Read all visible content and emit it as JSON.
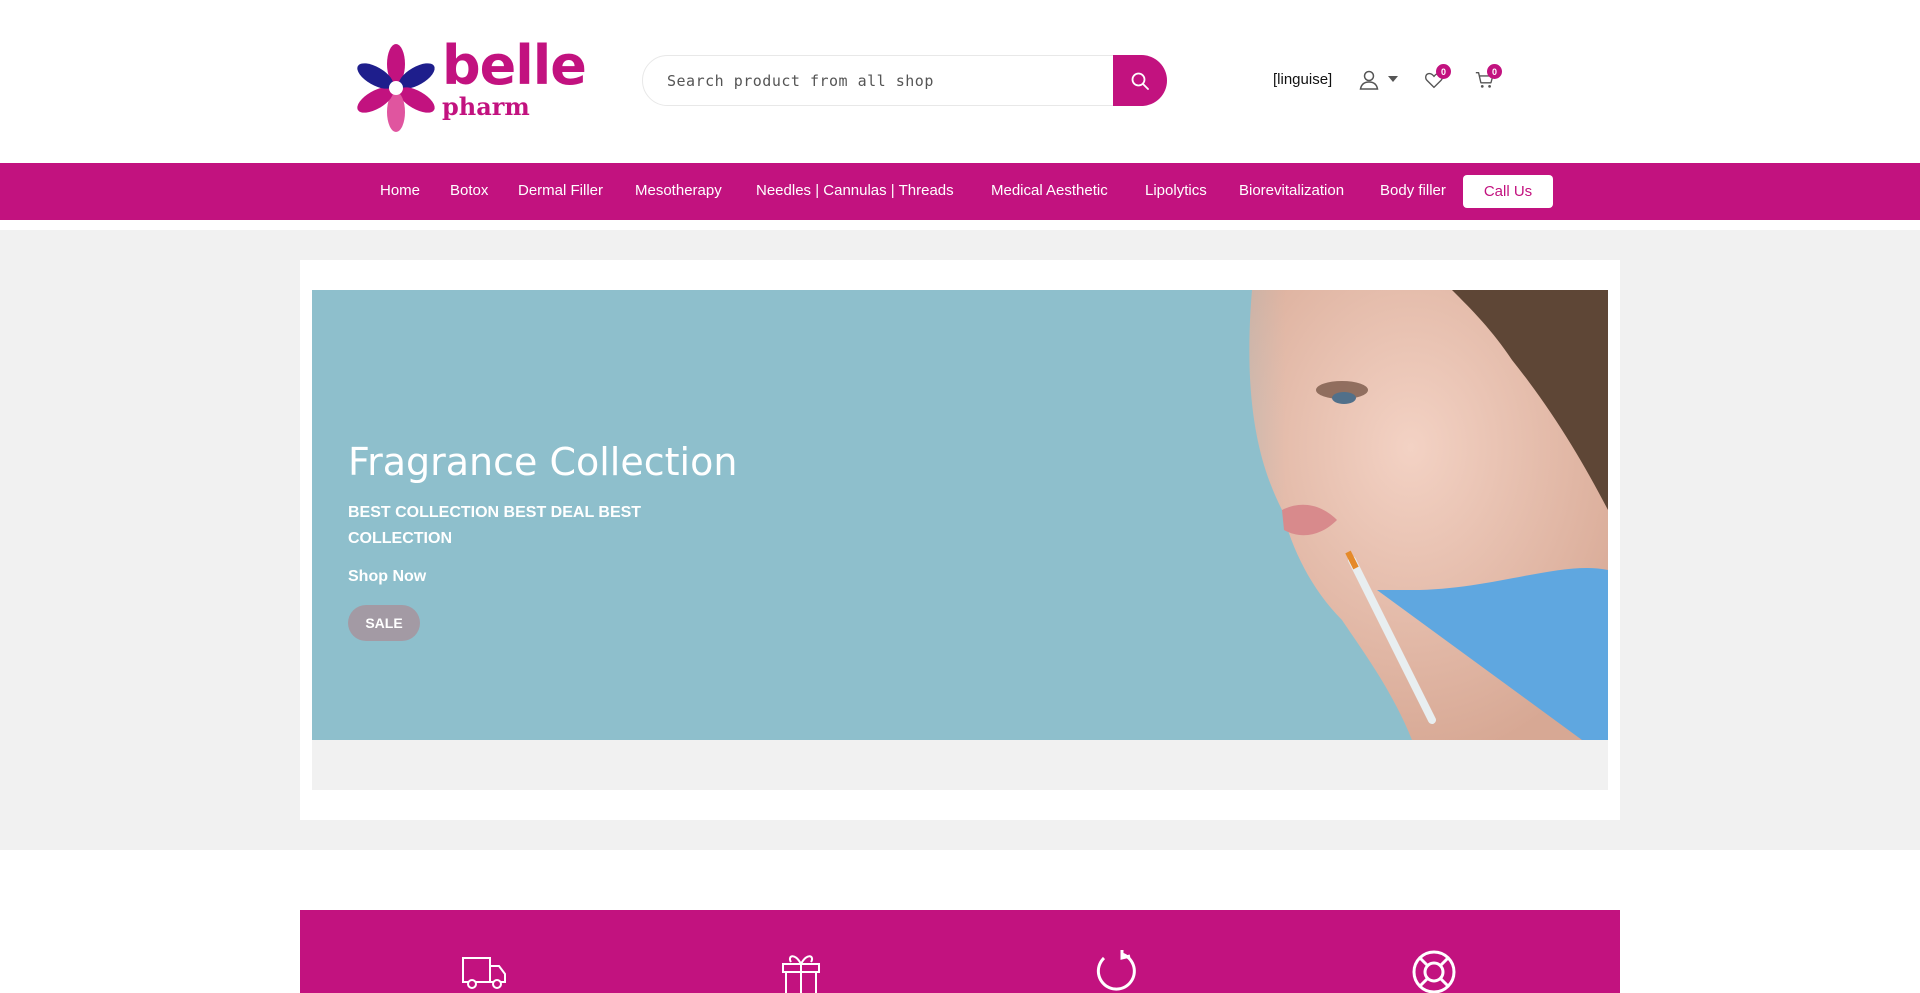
{
  "brand": {
    "name_main": "belle",
    "name_sub": "pharm",
    "accent": "#c2127f"
  },
  "search": {
    "placeholder": "Search product from all shop",
    "value": ""
  },
  "header": {
    "language": "[linguise]",
    "wishlist_count": "0",
    "cart_count": "0"
  },
  "nav": {
    "items": [
      {
        "label": "Home"
      },
      {
        "label": "Botox"
      },
      {
        "label": "Dermal Filler"
      },
      {
        "label": "Mesotherapy"
      },
      {
        "label": "Needles | Cannulas | Threads"
      },
      {
        "label": "Medical Aesthetic"
      },
      {
        "label": "Lipolytics"
      },
      {
        "label": "Biorevitalization"
      },
      {
        "label": "Body filler"
      }
    ],
    "call_label": "Call Us"
  },
  "hero": {
    "title": "Fragrance Collection",
    "subtitle": "BEST COLLECTION BEST DEAL BEST COLLECTION",
    "cta": "Shop Now",
    "badge": "SALE",
    "background": "#8ebfcc"
  },
  "features": {
    "icons": [
      "truck-icon",
      "gift-icon",
      "return-icon",
      "support-icon"
    ]
  }
}
